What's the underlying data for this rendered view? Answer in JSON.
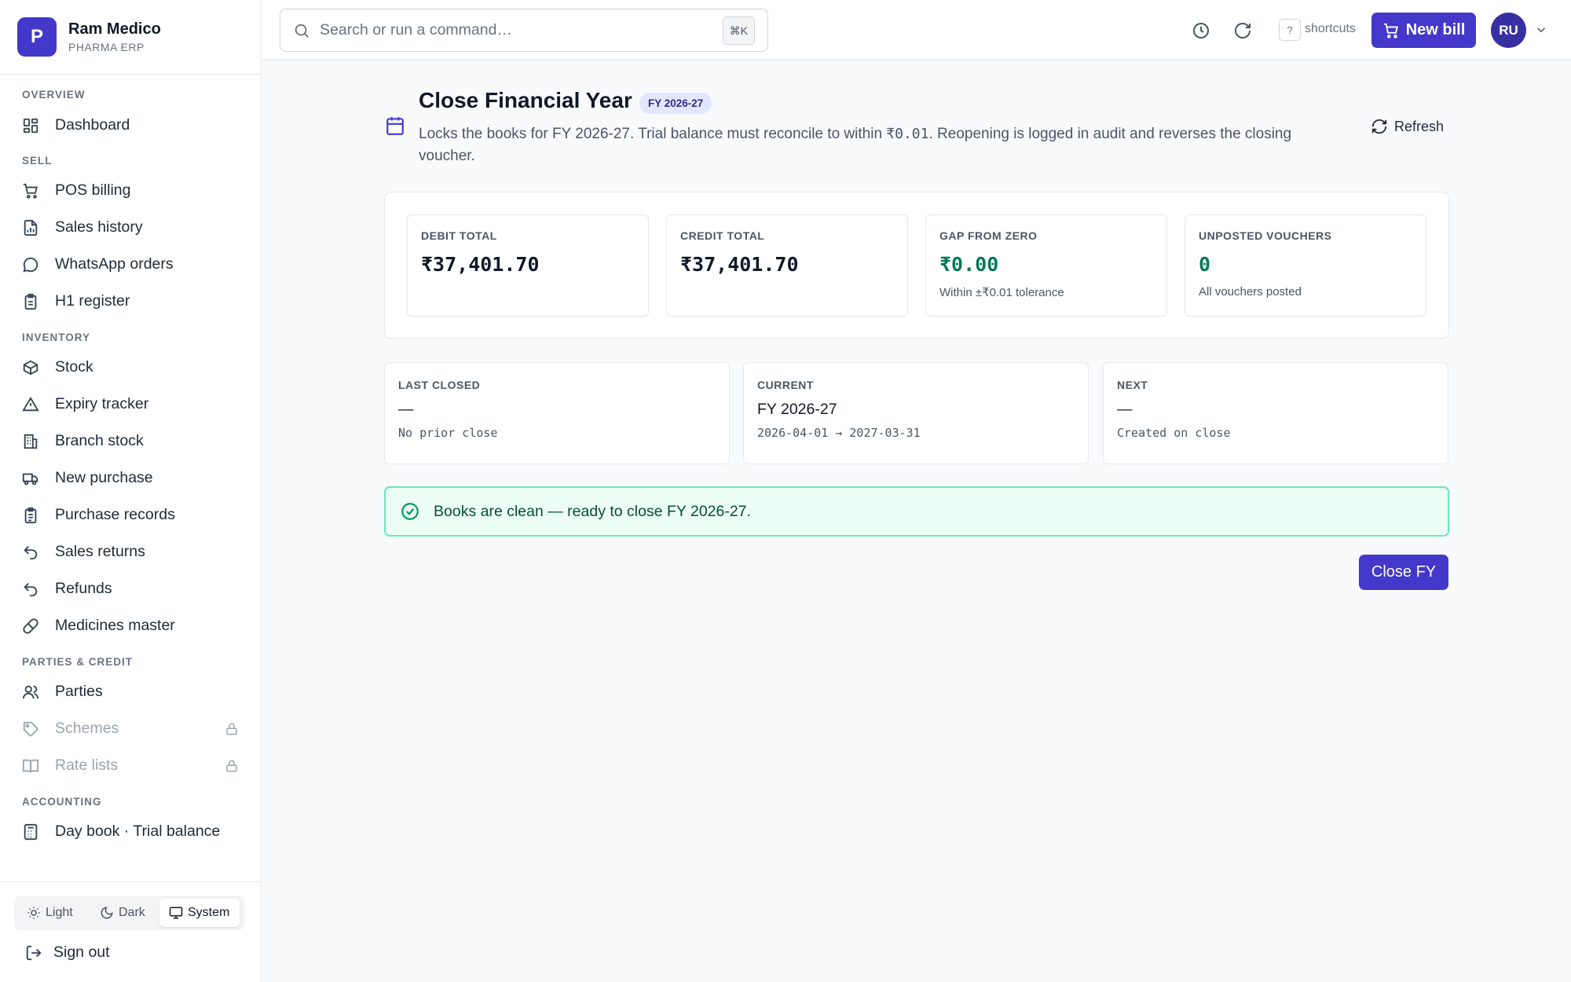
{
  "brand": {
    "logo_letter": "P",
    "name": "Ram Medico",
    "subtitle": "PHARMA ERP"
  },
  "sidebar": {
    "sections": [
      {
        "title": "OVERVIEW",
        "items": [
          {
            "label": "Dashboard",
            "icon": "dashboard-icon"
          }
        ]
      },
      {
        "title": "SELL",
        "items": [
          {
            "label": "POS billing",
            "icon": "cart-icon"
          },
          {
            "label": "Sales history",
            "icon": "file-chart-icon"
          },
          {
            "label": "WhatsApp orders",
            "icon": "chat-icon"
          },
          {
            "label": "H1 register",
            "icon": "clipboard-icon"
          }
        ]
      },
      {
        "title": "INVENTORY",
        "items": [
          {
            "label": "Stock",
            "icon": "box-icon"
          },
          {
            "label": "Expiry tracker",
            "icon": "warning-icon"
          },
          {
            "label": "Branch stock",
            "icon": "building-icon"
          },
          {
            "label": "New purchase",
            "icon": "truck-icon"
          },
          {
            "label": "Purchase records",
            "icon": "clipboard-list-icon"
          },
          {
            "label": "Sales returns",
            "icon": "undo-icon"
          },
          {
            "label": "Refunds",
            "icon": "undo-icon"
          },
          {
            "label": "Medicines master",
            "icon": "pill-icon"
          }
        ]
      },
      {
        "title": "PARTIES & CREDIT",
        "items": [
          {
            "label": "Parties",
            "icon": "users-icon"
          },
          {
            "label": "Schemes",
            "icon": "tag-icon",
            "locked": true
          },
          {
            "label": "Rate lists",
            "icon": "book-icon",
            "locked": true
          }
        ]
      },
      {
        "title": "ACCOUNTING",
        "items": [
          {
            "label": "Day book · Trial balance",
            "icon": "calculator-icon"
          }
        ]
      }
    ],
    "theme": {
      "light": "Light",
      "dark": "Dark",
      "system": "System",
      "selected": "System"
    },
    "signout": "Sign out"
  },
  "topbar": {
    "search_placeholder": "Search or run a command…",
    "search_shortcut": "⌘K",
    "shortcuts_key": "?",
    "shortcuts_label": "shortcuts",
    "new_bill": "New bill",
    "avatar_initials": "RU"
  },
  "page": {
    "title": "Close Financial Year",
    "badge": "FY 2026-27",
    "desc_before": "Locks the books for FY 2026-27. Trial balance must reconcile to within ",
    "desc_code": "₹0.01",
    "desc_after": ". Reopening is logged in audit and reverses the closing voucher.",
    "refresh": "Refresh"
  },
  "stats": [
    {
      "label": "DEBIT TOTAL",
      "value": "₹37,401.70",
      "note": ""
    },
    {
      "label": "CREDIT TOTAL",
      "value": "₹37,401.70",
      "note": ""
    },
    {
      "label": "GAP FROM ZERO",
      "value": "₹0.00",
      "note": "Within ±₹0.01 tolerance"
    },
    {
      "label": "UNPOSTED VOUCHERS",
      "value": "0",
      "note": "All vouchers posted"
    }
  ],
  "periods": [
    {
      "label": "LAST CLOSED",
      "value": "—",
      "sub": "No prior close"
    },
    {
      "label": "CURRENT",
      "value": "FY 2026-27",
      "sub": "2026-04-01 → 2027-03-31"
    },
    {
      "label": "NEXT",
      "value": "—",
      "sub": "Created on close"
    }
  ],
  "alert": {
    "text": "Books are clean — ready to close FY 2026-27."
  },
  "actions": {
    "close_fy": "Close FY"
  },
  "colors": {
    "accent": "#4338ca",
    "success": "#047857",
    "success_bg": "#ecfdf5"
  }
}
